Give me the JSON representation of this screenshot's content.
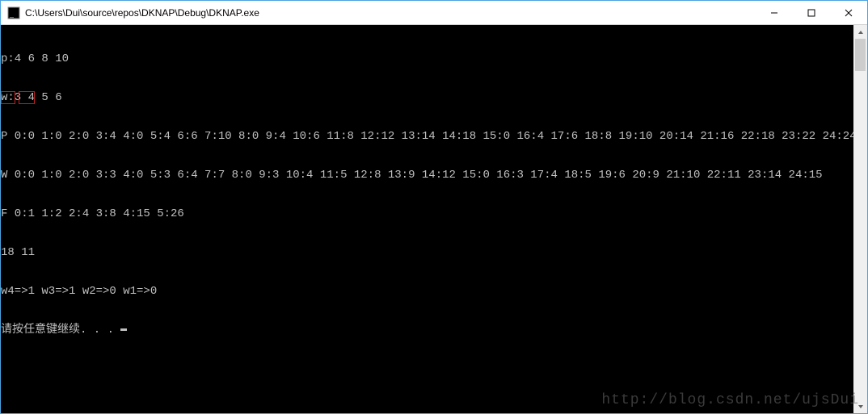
{
  "window": {
    "title": "C:\\Users\\Dui\\source\\repos\\DKNAP\\Debug\\DKNAP.exe"
  },
  "controls": {
    "minimize": "—",
    "maximize": "☐",
    "close": "✕"
  },
  "console": {
    "lines": [
      "p:4 6 8 10",
      "w:3 4 5 6",
      "P 0:0 1:0 2:0 3:4 4:0 5:4 6:6 7:10 8:0 9:4 10:6 11:8 12:12 13:14 14:18 15:0 16:4 17:6 18:8 19:10 20:14 21:16 22:18 23:22 24:24",
      "W 0:0 1:0 2:0 3:3 4:0 5:3 6:4 7:7 8:0 9:3 10:4 11:5 12:8 13:9 14:12 15:0 16:3 17:4 18:5 19:6 20:9 21:10 22:11 23:14 24:15",
      "F 0:1 1:2 2:4 3:8 4:15 5:26",
      "18 11",
      "w4=>1 w3=>1 w2=>0 w1=>0",
      "请按任意键继续. . . "
    ]
  },
  "highlight": {
    "value1": "18",
    "value2": "11"
  },
  "watermark": "http://blog.csdn.net/ujsDui"
}
